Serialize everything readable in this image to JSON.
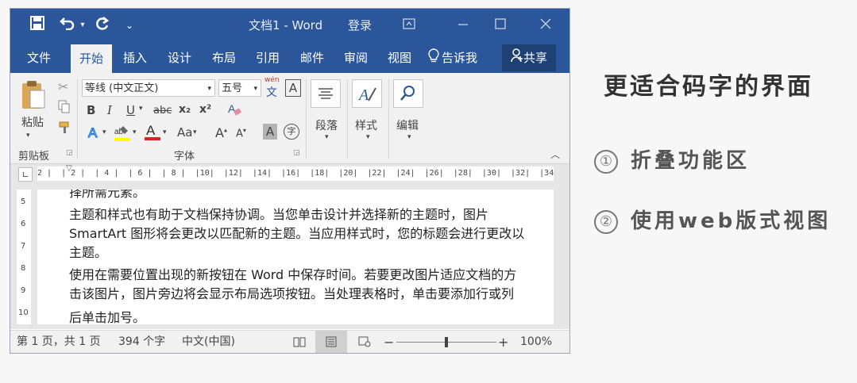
{
  "window": {
    "title_doc": "文档1",
    "title_sep": "-",
    "title_app": "Word",
    "login": "登录"
  },
  "quick_access": {
    "save_icon": "save-icon",
    "undo_icon": "undo-icon",
    "redo_icon": "redo-icon",
    "customize_icon": "customize-icon"
  },
  "tabs": [
    "文件",
    "开始",
    "插入",
    "设计",
    "布局",
    "引用",
    "邮件",
    "审阅",
    "视图"
  ],
  "active_tab": "开始",
  "tell_me": "告诉我",
  "share": "共享",
  "ribbon": {
    "paste": "粘贴",
    "clipboard_group": "剪贴板",
    "font_name": "等线 (中文正文)",
    "font_size": "五号",
    "wen": "wén",
    "wen_char": "文",
    "A_box": "A",
    "bold": "B",
    "italic": "I",
    "underline": "U",
    "strike": "abc",
    "subscript": "x₂",
    "superscript": "x²",
    "font_group": "字体",
    "change_case": "Aa",
    "grow": "A",
    "shrink": "A",
    "char_shade": "A",
    "enclose": "字",
    "paragraph": "段落",
    "styles": "样式",
    "editing": "编辑",
    "accent_blue": "#2b579a",
    "highlight_color": "#ffff00",
    "font_color": "#e02020"
  },
  "ruler": {
    "h_marks": "2 |  | 2 |  | 4 |  | 6 |  | 8 |  |10|  |12|  |14|  |16|  |18|  |20|  |22|  |24|  |26|  |28|  |30|  |32|  |34|",
    "v_marks": [
      "5",
      "6",
      "7",
      "8",
      "9",
      "10"
    ]
  },
  "document": {
    "lines": [
      "择所需元素。",
      "主题和样式也有助于文档保持协调。当您单击设计并选择新的主题时，图片",
      "SmartArt 图形将会更改以匹配新的主题。当应用样式时，您的标题会进行更改以",
      "主题。",
      "使用在需要位置出现的新按钮在 Word 中保存时间。若要更改图片适应文档的方",
      "击该图片，图片旁边将会显示布局选项按钮。当处理表格时，单击要添加行或列",
      "后单击加号。"
    ]
  },
  "status": {
    "page": "第 1 页，共 1 页",
    "words": "394 个字",
    "language": "中文(中国)",
    "zoom_minus": "−",
    "zoom_plus": "+",
    "zoom": "100%",
    "zoom_level": 100
  },
  "side": {
    "title": "更适合码字的界面",
    "items": [
      {
        "num": "①",
        "text": "折叠功能区"
      },
      {
        "num": "②",
        "text": "使用web版式视图"
      }
    ]
  }
}
